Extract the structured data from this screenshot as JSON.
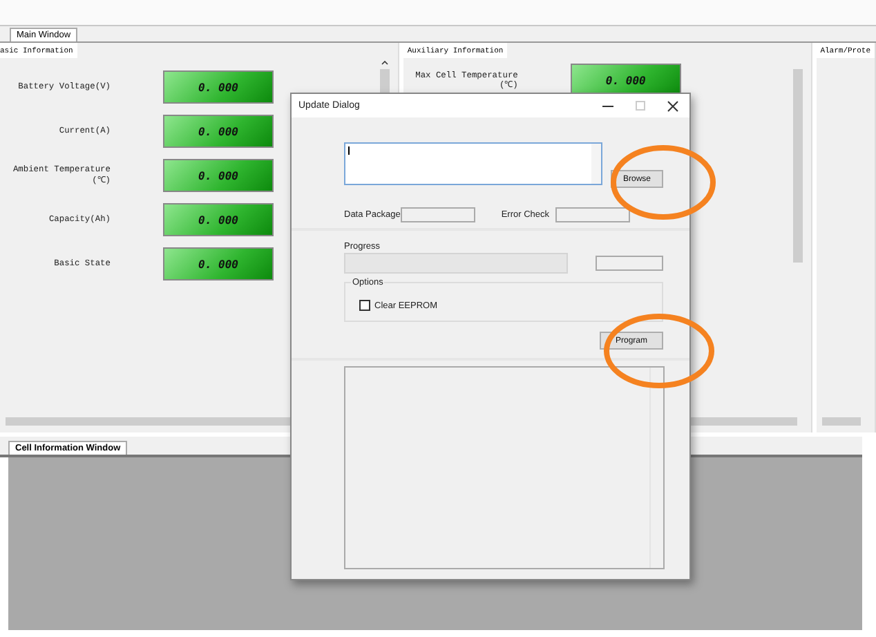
{
  "main_tabs": [
    {
      "label": "Main Window",
      "selected": true
    }
  ],
  "basic_panel": {
    "title": "asic Information",
    "rows": [
      {
        "label": "Battery Voltage(V)",
        "value": "0. 000"
      },
      {
        "label": "Current(A)",
        "value": "0. 000"
      },
      {
        "label": "Ambient Temperature\n(℃)",
        "value": "0. 000"
      },
      {
        "label": "Capacity(Ah)",
        "value": "0. 000"
      },
      {
        "label": "Basic State",
        "value": "0. 000"
      }
    ]
  },
  "aux_panel": {
    "title": "Auxiliary Information",
    "rows": [
      {
        "label": "Max Cell Temperature\n(℃)",
        "value": "0. 000"
      }
    ]
  },
  "alarm_panel": {
    "title": "Alarm/Prote"
  },
  "bottom_tabs": [
    {
      "label": "Cell Information Window",
      "selected": true
    }
  ],
  "dialog": {
    "title": "Update Dialog",
    "browse_button": "Browse",
    "data_package_label": "Data Package",
    "error_check_label": "Error Check",
    "progress_label": "Progress",
    "progress": {
      "level": 0.0
    },
    "options_title": "Options",
    "clear_eeprom": {
      "label": "Clear EEPROM",
      "checked": false
    },
    "program_button": "Program"
  }
}
